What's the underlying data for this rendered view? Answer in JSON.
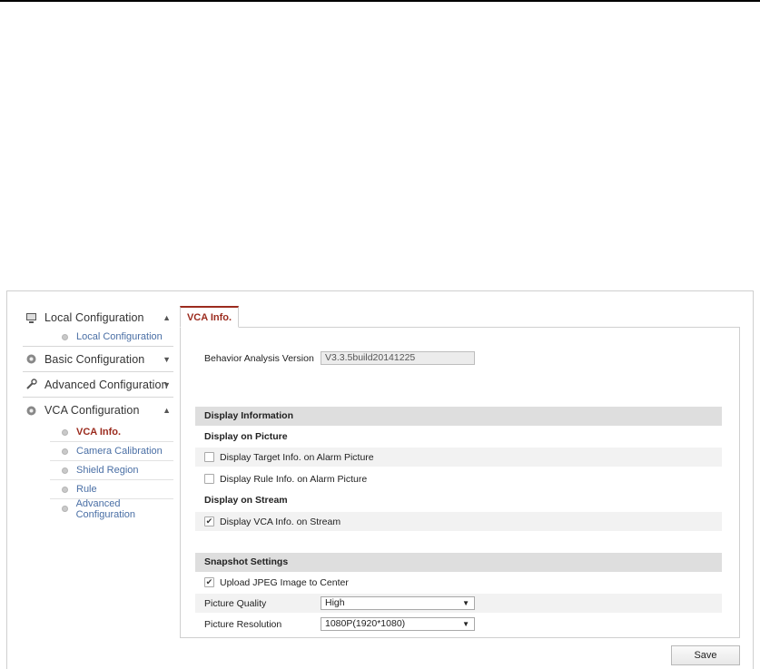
{
  "sidebar": {
    "groups": [
      {
        "label": "Local Configuration",
        "icon": "monitor-icon",
        "chevron": "up",
        "items": [
          {
            "label": "Local Configuration"
          }
        ]
      },
      {
        "label": "Basic Configuration",
        "icon": "gear-icon",
        "chevron": "down",
        "items": []
      },
      {
        "label": "Advanced Configuration",
        "icon": "wrench-icon",
        "chevron": "down",
        "items": []
      },
      {
        "label": "VCA Configuration",
        "icon": "gear-icon",
        "chevron": "up",
        "items": [
          {
            "label": "VCA Info.",
            "active": true
          },
          {
            "label": "Camera Calibration"
          },
          {
            "label": "Shield Region"
          },
          {
            "label": "Rule"
          },
          {
            "label": "Advanced Configuration"
          }
        ]
      }
    ]
  },
  "tab": {
    "label": "VCA Info."
  },
  "version": {
    "label": "Behavior Analysis Version",
    "value": "V3.3.5build20141225"
  },
  "display_info": {
    "header": "Display Information",
    "picture_header": "Display on Picture",
    "target_label": "Display Target Info. on Alarm Picture",
    "target_checked": false,
    "rule_label": "Display Rule Info. on Alarm Picture",
    "rule_checked": false,
    "stream_header": "Display on Stream",
    "vca_label": "Display VCA Info. on Stream",
    "vca_checked": true
  },
  "snapshot": {
    "header": "Snapshot Settings",
    "upload_label": "Upload JPEG Image to Center",
    "upload_checked": true,
    "quality_label": "Picture Quality",
    "quality_value": "High",
    "resolution_label": "Picture Resolution",
    "resolution_value": "1080P(1920*1080)"
  },
  "save_label": "Save",
  "colors": {
    "accent": "#9b2b1e",
    "link": "#4a6fa5",
    "section_bg": "#dedede"
  }
}
